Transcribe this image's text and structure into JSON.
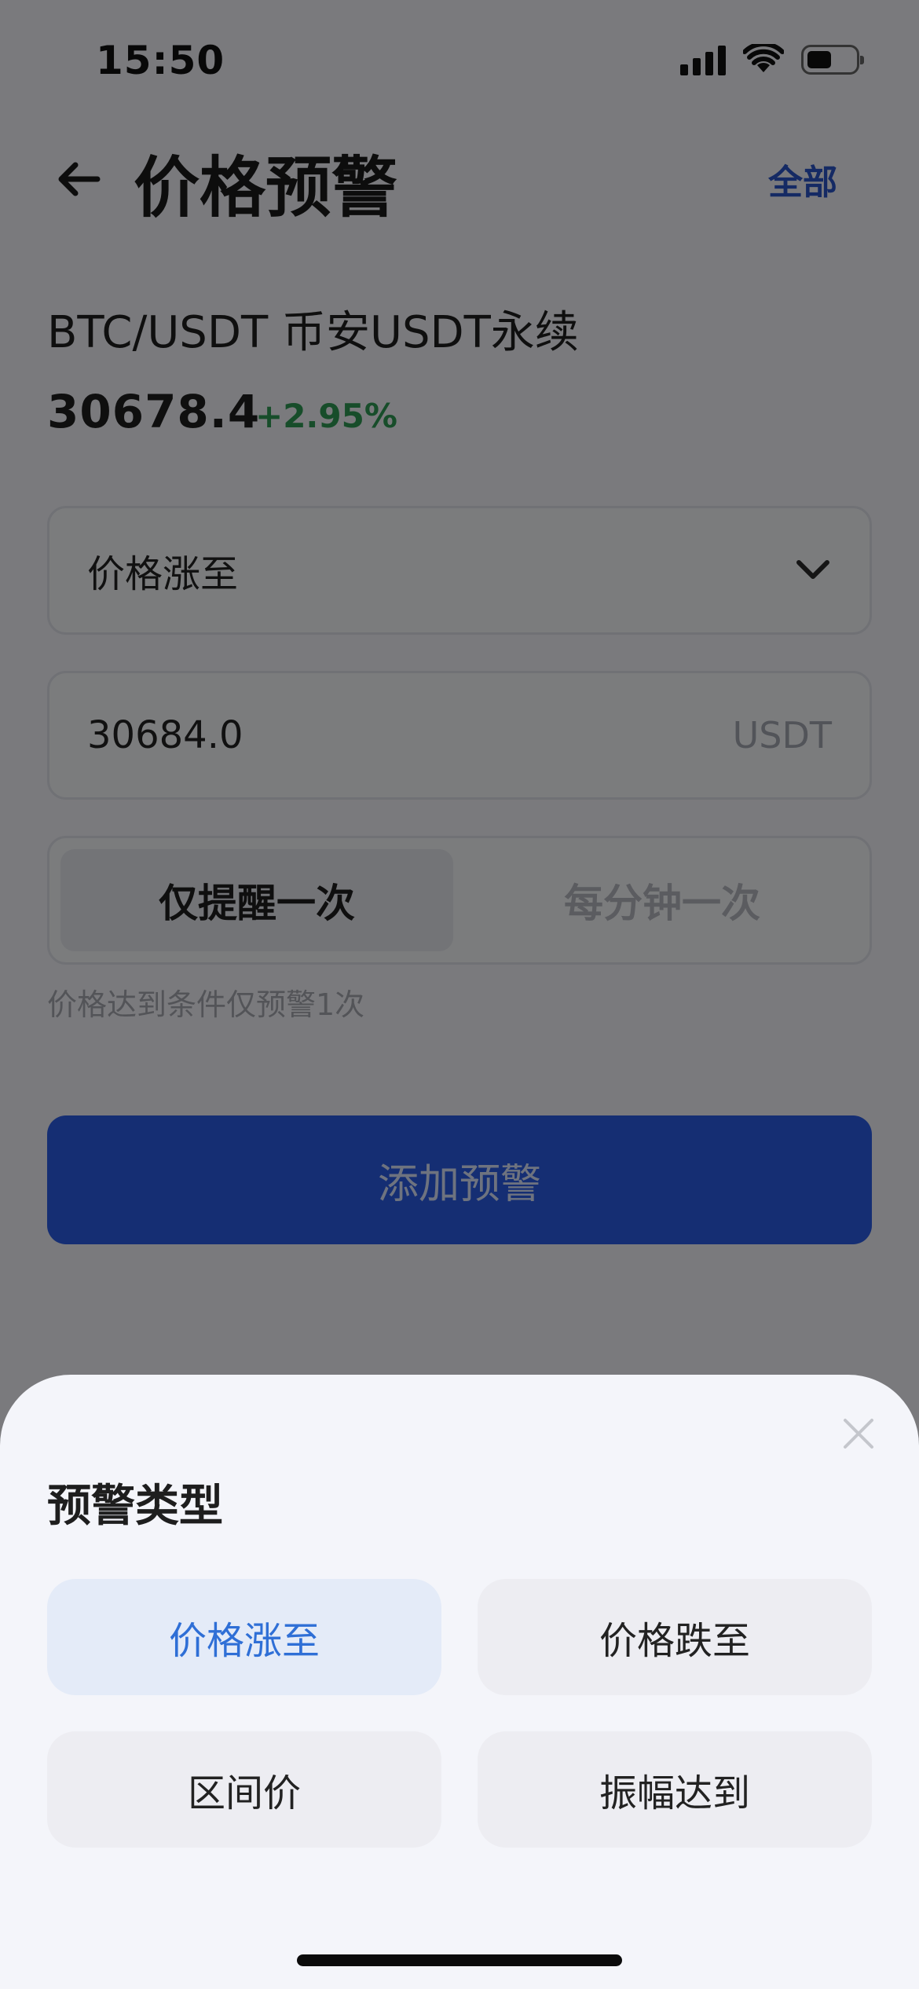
{
  "status_bar": {
    "time": "15:50"
  },
  "header": {
    "title": "价格预警",
    "all_label": "全部"
  },
  "market": {
    "pair": "BTC/USDT 币安USDT永续",
    "price": "30678.4",
    "change": "+2.95%"
  },
  "form": {
    "alert_type_value": "价格涨至",
    "price_value": "30684.0",
    "price_unit": "USDT",
    "frequency_options": [
      "仅提醒一次",
      "每分钟一次"
    ],
    "frequency_selected": "仅提醒一次",
    "hint": "价格达到条件仅预警1次",
    "submit_label": "添加预警"
  },
  "sheet": {
    "title": "预警类型",
    "options": [
      "价格涨至",
      "价格跌至",
      "区间价",
      "振幅达到"
    ],
    "selected": "价格涨至"
  },
  "colors": {
    "accent": "#2b5ce6",
    "link": "#2b55c9",
    "positive": "#2e9b55",
    "selected_option_text": "#2f6fd6",
    "selected_option_bg": "#e4ebf8"
  },
  "icons": [
    "back-arrow-icon",
    "chevron-down-icon",
    "close-icon",
    "signal-icon",
    "wifi-icon",
    "battery-icon"
  ]
}
